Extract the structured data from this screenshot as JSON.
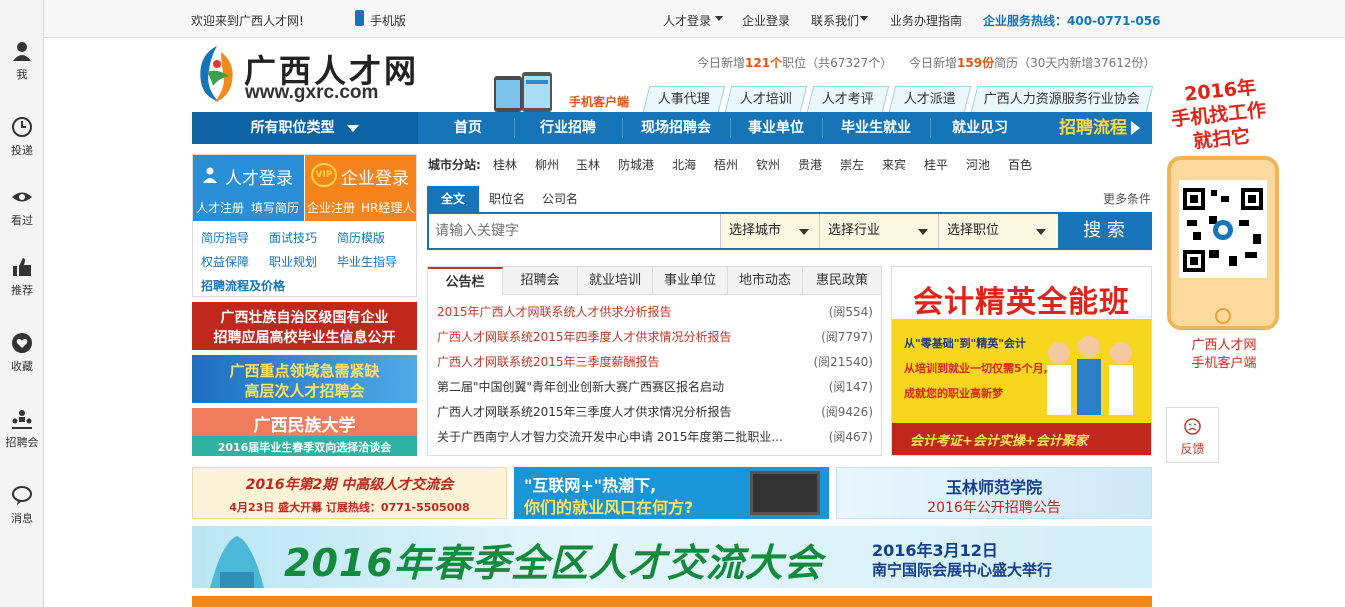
{
  "rail": [
    {
      "label": "我",
      "icon": "user-icon"
    },
    {
      "label": "投递",
      "icon": "clock-icon"
    },
    {
      "label": "看过",
      "icon": "eye-icon"
    },
    {
      "label": "推荐",
      "icon": "thumbs-up-icon"
    },
    {
      "label": "收藏",
      "icon": "heart-icon"
    },
    {
      "label": "招聘会",
      "icon": "people-icon"
    },
    {
      "label": "消息",
      "icon": "chat-icon"
    }
  ],
  "topbar": {
    "welcome": "欢迎来到广西人才网!",
    "mobile": "手机版",
    "talent_login": "人才登录",
    "company_login": "企业登录",
    "contact": "联系我们",
    "guide": "业务办理指南",
    "hotline": "企业服务热线：400-0771-056"
  },
  "header": {
    "logo_cn": "广西人才网",
    "logo_en": "www.gxrc.com",
    "stat_jobs_prefix": "今日新增",
    "stat_jobs_count": "121个",
    "stat_jobs_suffix": "职位（共67327个）",
    "stat_resume_prefix": "今日新增",
    "stat_resume_count": "159份",
    "stat_resume_suffix": "简历（30天内新增37612份）",
    "mobile_client": "手机客户端",
    "subtabs": [
      "人事代理",
      "人才培训",
      "人才考评",
      "人才派遣",
      "广西人力资源服务行业协会"
    ]
  },
  "nav": {
    "all_jobs": "所有职位类型",
    "items": [
      "首页",
      "行业招聘",
      "现场招聘会",
      "事业单位",
      "毕业生就业",
      "就业见习"
    ],
    "process": "招聘流程"
  },
  "login": {
    "talent_title": "人才登录",
    "talent_register": "人才注册",
    "talent_resume": "填写简历",
    "vip": "VIP",
    "company_title": "企业登录",
    "company_register": "企业注册",
    "hr_manager": "HR经理人",
    "links": [
      "简历指导",
      "面试技巧",
      "简历模版",
      "权益保障",
      "职业规划",
      "毕业生指导"
    ],
    "pricing": "招聘流程及价格"
  },
  "left_banners": [
    {
      "line1": "广西壮族自治区级国有企业",
      "line2": "招聘应届高校毕业生信息公开"
    },
    {
      "line1": "广西重点领域急需紧缺",
      "line2": "高层次人才招聘会"
    },
    {
      "line1": "广西民族大学",
      "line2": "2016届毕业生春季双向选择洽谈会"
    }
  ],
  "city": {
    "label": "城市分站:",
    "items": [
      "桂林",
      "柳州",
      "玉林",
      "防城港",
      "北海",
      "梧州",
      "钦州",
      "贵港",
      "崇左",
      "来宾",
      "桂平",
      "河池",
      "百色"
    ]
  },
  "search": {
    "tabs": [
      "全文",
      "职位名",
      "公司名"
    ],
    "more": "更多条件",
    "placeholder": "请输入关键字",
    "city": "选择城市",
    "industry": "选择行业",
    "position": "选择职位",
    "button": "搜 索"
  },
  "news": {
    "tabs": [
      "公告栏",
      "招聘会",
      "就业培训",
      "事业单位",
      "地市动态",
      "惠民政策"
    ],
    "items": [
      {
        "title": "2015年广西人才网联系统人才供求分析报告",
        "count": "(阅554)"
      },
      {
        "title": "广西人才网联系统2015年四季度人才供求情况分析报告",
        "count": "(阅7797)"
      },
      {
        "title": "广西人才网联系统2015年三季度薪酬报告",
        "count": "(阅21540)"
      },
      {
        "title": "第二届\"中国创翼\"青年创业创新大赛广西赛区报名启动",
        "count": "(阅147)"
      },
      {
        "title": "广西人才网联系统2015年三季度人才供求情况分析报告",
        "count": "(阅9426)"
      },
      {
        "title": "关于广西南宁人才智力交流开发中心申请 2015年度第二批职业...",
        "count": "(阅467)"
      }
    ]
  },
  "ad_accounting": {
    "title": "会计精英全能班",
    "line1": "从\"零基础\"到\"精英\"会计",
    "line2": "从培训到就业一切仅需5个月,",
    "line3": "成就您的职业高新梦",
    "footer": "会计考证+会计实操+会计聚家"
  },
  "mid_banners": [
    {
      "line1": "2016年第2期 中高级人才交流会",
      "line2": "4月23日 盛大开幕   订展热线：0771-5505008"
    },
    {
      "line1": "\"互联网+\"热潮下,",
      "line2": "你们的就业风口在何方?"
    },
    {
      "line1": "玉林师范学院",
      "line2": "2016年公开招聘公告"
    }
  ],
  "big_banner": {
    "title": "2016年春季全区人才交流大会",
    "date": "2016年3月12日",
    "venue": "南宁国际会展中心盛大举行"
  },
  "right": {
    "ad_line1": "2016年",
    "ad_line2": "手机找工作",
    "ad_line3": "就扫它",
    "caption1": "广西人才网",
    "caption2": "手机客户端",
    "feedback": "反馈"
  }
}
